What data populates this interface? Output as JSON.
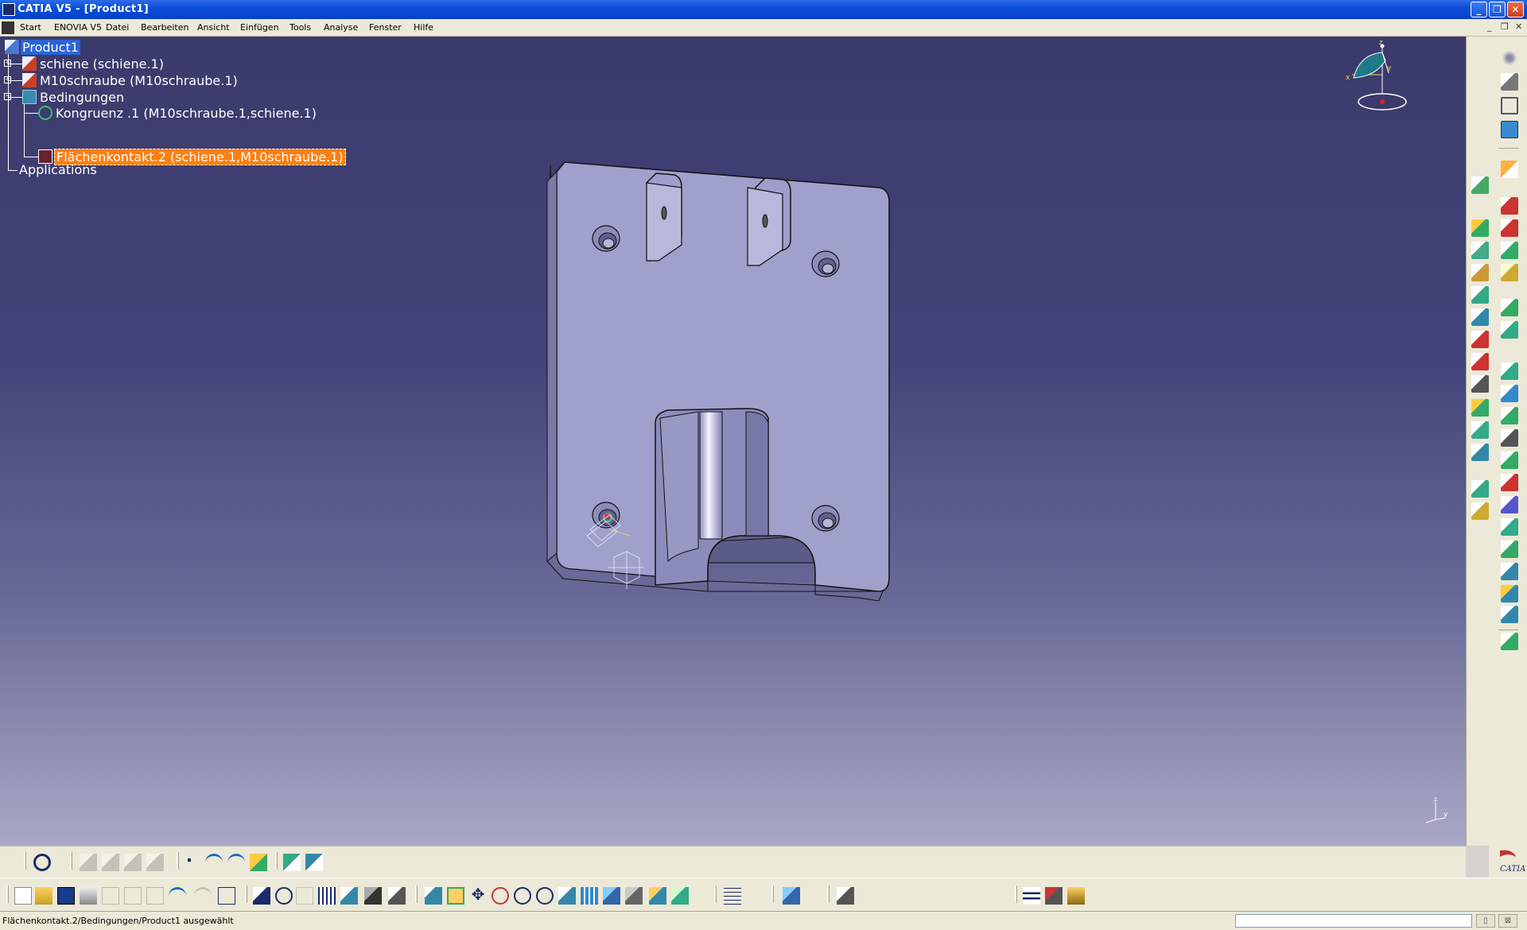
{
  "window": {
    "title": "CATIA V5 - [Product1]",
    "minimize_glyph": "_",
    "restore_glyph": "❐",
    "close_glyph": "✕"
  },
  "menubar": {
    "items": [
      "Start",
      "ENOVIA V5",
      "Datei",
      "Bearbeiten",
      "Ansicht",
      "Einfügen",
      "Tools",
      "Analyse",
      "Fenster",
      "Hilfe"
    ],
    "doc_controls": [
      "_",
      "❐",
      "✕"
    ]
  },
  "tree": {
    "root": "Product1",
    "nodes": [
      {
        "label": "schiene (schiene.1)",
        "icon": "part-icon",
        "expander": "+"
      },
      {
        "label": "M10schraube (M10schraube.1)",
        "icon": "part-icon",
        "expander": "+"
      },
      {
        "label": "Bedingungen",
        "icon": "constraints-icon",
        "expander": "−"
      },
      {
        "label": "Kongruenz .1 (M10schraube.1,schiene.1)",
        "icon": "coincidence-icon"
      },
      {
        "label": "Flächenkontakt.2 (schiene.1,M10schraube.1)",
        "icon": "contact-icon",
        "selected": true
      },
      {
        "label": "Applications",
        "icon": "none"
      }
    ]
  },
  "compass": {
    "axes": [
      "z",
      "y",
      "x"
    ]
  },
  "axis_mini": {
    "labels": [
      "z",
      "y"
    ]
  },
  "logo": {
    "text": "CATIA"
  },
  "status": {
    "message": "Flächenkontakt.2/Bedingungen/Product1 ausgewählt",
    "command_value": ""
  },
  "colors": {
    "viewport_top": "#3a3a6c",
    "viewport_bottom": "#a9a9c6",
    "selection_orange": "#ff7f10",
    "selection_blue": "#2b64d8",
    "titlebar": "#0a4fd8"
  }
}
